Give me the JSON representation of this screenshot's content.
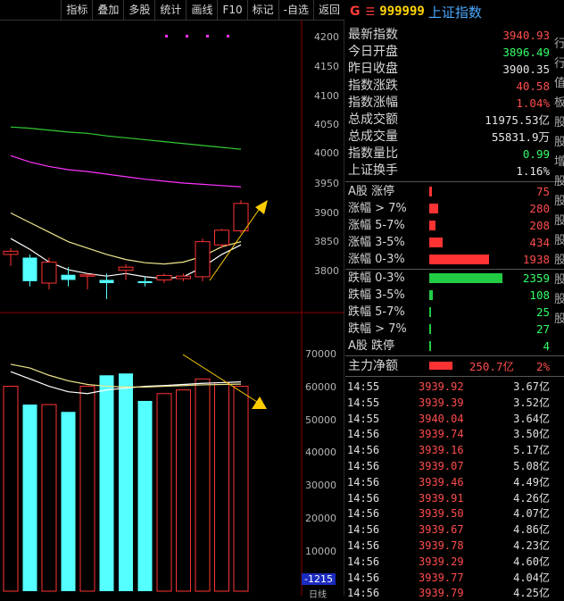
{
  "toolbar": [
    "指标",
    "叠加",
    "多股",
    "统计",
    "画线",
    "F10",
    "标记",
    "-自选",
    "返回"
  ],
  "price_axis": [
    "4200",
    "4150",
    "4100",
    "4050",
    "4000",
    "3950",
    "3900",
    "3850",
    "3800"
  ],
  "volume_axis": [
    "70000",
    "60000",
    "50000",
    "40000",
    "30000",
    "20000",
    "10000"
  ],
  "volume_readout": "-1215",
  "bottom_label": "日线",
  "colors": {
    "up": "#ff3333",
    "down": "#54ffff",
    "ma5": "#ffffff",
    "ma10": "#f0e68c",
    "ma20": "#ff33ff",
    "ma60": "#33cc33",
    "arrow": "#ffcc00",
    "text_red": "#ff4d4d",
    "text_green": "#33ff66",
    "cyan": "#00d8ff"
  },
  "chart_data": [
    {
      "type": "candlestick",
      "ylim": [
        3780,
        4220
      ],
      "candles": [
        {
          "o": 3860,
          "h": 3870,
          "l": 3842,
          "c": 3865,
          "dir": "up"
        },
        {
          "o": 3855,
          "h": 3860,
          "l": 3810,
          "c": 3818,
          "dir": "down"
        },
        {
          "o": 3848,
          "h": 3855,
          "l": 3805,
          "c": 3815,
          "dir": "up"
        },
        {
          "o": 3828,
          "h": 3840,
          "l": 3810,
          "c": 3820,
          "dir": "down"
        },
        {
          "o": 3826,
          "h": 3830,
          "l": 3805,
          "c": 3828,
          "dir": "up"
        },
        {
          "o": 3820,
          "h": 3830,
          "l": 3790,
          "c": 3815,
          "dir": "down"
        },
        {
          "o": 3835,
          "h": 3845,
          "l": 3820,
          "c": 3840,
          "dir": "up"
        },
        {
          "o": 3818,
          "h": 3825,
          "l": 3810,
          "c": 3815,
          "dir": "down"
        },
        {
          "o": 3820,
          "h": 3830,
          "l": 3815,
          "c": 3827,
          "dir": "up"
        },
        {
          "o": 3822,
          "h": 3830,
          "l": 3818,
          "c": 3826,
          "dir": "up"
        },
        {
          "o": 3825,
          "h": 3885,
          "l": 3818,
          "c": 3880,
          "dir": "up"
        },
        {
          "o": 3875,
          "h": 3900,
          "l": 3870,
          "c": 3898,
          "dir": "up"
        },
        {
          "o": 3897,
          "h": 3945,
          "l": 3893,
          "c": 3940,
          "dir": "up"
        }
      ],
      "ma5": [
        3885,
        3868,
        3848,
        3836,
        3830,
        3826,
        3830,
        3825,
        3822,
        3825,
        3840,
        3860,
        3875
      ],
      "ma10": [
        3925,
        3910,
        3895,
        3880,
        3870,
        3860,
        3852,
        3847,
        3845,
        3848,
        3857,
        3872,
        3880
      ],
      "ma20": [
        4015,
        4005,
        3998,
        3993,
        3990,
        3986,
        3982,
        3978,
        3975,
        3972,
        3970,
        3968,
        3966
      ],
      "ma60": [
        4060,
        4058,
        4055,
        4052,
        4050,
        4046,
        4043,
        4040,
        4037,
        4034,
        4031,
        4028,
        4025
      ]
    },
    {
      "type": "bar",
      "ylim": [
        0,
        72000
      ],
      "values": [
        56000,
        51000,
        51000,
        49000,
        56000,
        59000,
        59500,
        52000,
        54000,
        55000,
        58000,
        57000,
        56000
      ],
      "dirs": [
        "up",
        "down",
        "up",
        "down",
        "up",
        "down",
        "down",
        "down",
        "up",
        "up",
        "up",
        "up",
        "up"
      ],
      "ma5": [
        60000,
        58000,
        56000,
        54500,
        54000,
        55000,
        55500,
        56000,
        56200,
        56500,
        56800,
        57000,
        57200
      ],
      "ma10": [
        62000,
        61000,
        59000,
        57500,
        56500,
        56000,
        55800,
        55800,
        56000,
        56200,
        56400,
        56500,
        56600
      ]
    }
  ],
  "quote": {
    "flag": "G",
    "menu_icon": "menu-icon",
    "code": "999999",
    "name": "上证指数",
    "rows": [
      {
        "k": "最新指数",
        "v": "3940.93",
        "c": "red"
      },
      {
        "k": "今日开盘",
        "v": "3896.49",
        "c": "green"
      },
      {
        "k": "昨日收盘",
        "v": "3900.35",
        "c": "white"
      },
      {
        "k": "指数涨跌",
        "v": "40.58",
        "c": "red"
      },
      {
        "k": "指数涨幅",
        "v": "1.04%",
        "c": "red"
      },
      {
        "k": "总成交额",
        "v": "11975.53亿",
        "c": "white"
      },
      {
        "k": "总成交量",
        "v": "55831.9万",
        "c": "white"
      },
      {
        "k": "指数量比",
        "v": "0.99",
        "c": "green"
      },
      {
        "k": "上证换手",
        "v": "1.16%",
        "c": "white"
      }
    ],
    "dist": [
      {
        "k": "A股 涨停",
        "v": "75",
        "n": 75,
        "c": "red"
      },
      {
        "k": "涨幅 > 7%",
        "v": "280",
        "n": 280,
        "c": "red"
      },
      {
        "k": "涨幅 5-7%",
        "v": "208",
        "n": 208,
        "c": "red"
      },
      {
        "k": "涨幅 3-5%",
        "v": "434",
        "n": 434,
        "c": "red"
      },
      {
        "k": "涨幅 0-3%",
        "v": "1938",
        "n": 1938,
        "c": "red"
      },
      {
        "k": "跌幅 0-3%",
        "v": "2359",
        "n": 2359,
        "c": "green"
      },
      {
        "k": "跌幅 3-5%",
        "v": "108",
        "n": 108,
        "c": "green"
      },
      {
        "k": "跌幅 5-7%",
        "v": "25",
        "n": 25,
        "c": "green"
      },
      {
        "k": "跌幅 > 7%",
        "v": "27",
        "n": 27,
        "c": "green"
      },
      {
        "k": "A股 跌停",
        "v": "4",
        "n": 4,
        "c": "green"
      }
    ],
    "net": {
      "k": "主力净额",
      "v": "250.7亿",
      "pct": "2%"
    },
    "ticks": [
      {
        "t": "14:55",
        "p": "3939.92",
        "a": "3.67亿"
      },
      {
        "t": "14:55",
        "p": "3939.39",
        "a": "3.52亿"
      },
      {
        "t": "14:55",
        "p": "3940.04",
        "a": "3.64亿"
      },
      {
        "t": "14:56",
        "p": "3939.74",
        "a": "3.50亿"
      },
      {
        "t": "14:56",
        "p": "3939.16",
        "a": "5.17亿"
      },
      {
        "t": "14:56",
        "p": "3939.07",
        "a": "5.08亿"
      },
      {
        "t": "14:56",
        "p": "3939.46",
        "a": "4.49亿"
      },
      {
        "t": "14:56",
        "p": "3939.91",
        "a": "4.26亿"
      },
      {
        "t": "14:56",
        "p": "3939.50",
        "a": "4.07亿"
      },
      {
        "t": "14:56",
        "p": "3939.67",
        "a": "4.86亿"
      },
      {
        "t": "14:56",
        "p": "3939.78",
        "a": "4.23亿"
      },
      {
        "t": "14:56",
        "p": "3939.29",
        "a": "4.60亿"
      },
      {
        "t": "14:56",
        "p": "3939.77",
        "a": "4.04亿"
      },
      {
        "t": "14:56",
        "p": "3939.79",
        "a": "4.25亿"
      }
    ]
  },
  "edge": [
    "行",
    "行",
    "值",
    "板",
    "股",
    "股",
    "增",
    "股",
    "股",
    "股",
    "股",
    "股",
    "股",
    "股",
    "股"
  ]
}
